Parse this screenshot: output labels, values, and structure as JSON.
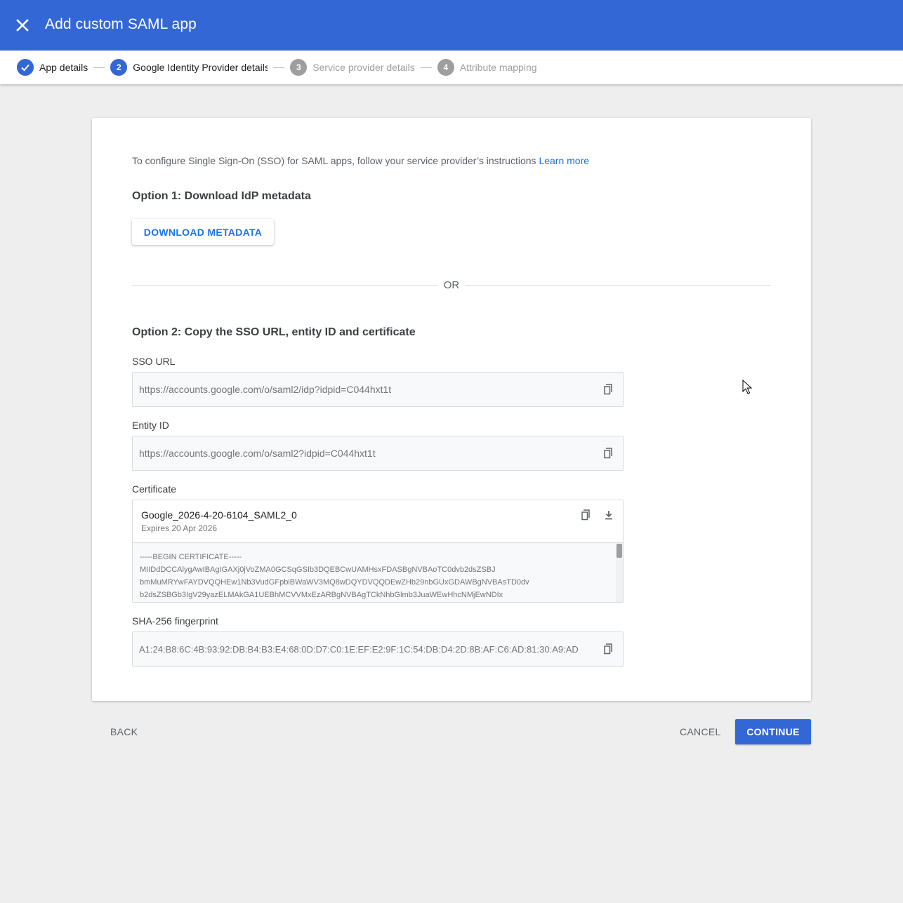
{
  "header": {
    "title": "Add custom SAML app",
    "close_icon": "close-icon",
    "color": "#3367d6"
  },
  "stepper": {
    "steps": [
      {
        "number": "",
        "label": "App details",
        "state": "done"
      },
      {
        "number": "2",
        "label": "Google Identity Provider details",
        "state": "active"
      },
      {
        "number": "3",
        "label": "Service provider details",
        "state": "todo"
      },
      {
        "number": "4",
        "label": "Attribute mapping",
        "state": "todo"
      }
    ]
  },
  "content": {
    "intro_text": "To configure Single Sign-On (SSO) for SAML apps, follow your service provider’s instructions ",
    "learn_more": "Learn more",
    "option1_heading": "Option 1: Download IdP metadata",
    "download_button": "DOWNLOAD METADATA",
    "or_text": "OR",
    "option2_heading": "Option 2: Copy the SSO URL, entity ID and certificate",
    "sso_url": {
      "label": "SSO URL",
      "value": "https://accounts.google.com/o/saml2/idp?idpid=C044hxt1t"
    },
    "entity_id": {
      "label": "Entity ID",
      "value": "https://accounts.google.com/o/saml2?idpid=C044hxt1t"
    },
    "certificate": {
      "label": "Certificate",
      "name": "Google_2026-4-20-6104_SAML2_0",
      "expires": "Expires 20 Apr 2026",
      "body": "-----BEGIN CERTIFICATE-----\nMIIDdDCCAlygAwIBAgIGAXj0jVoZMA0GCSqGSIb3DQEBCwUAMHsxFDASBgNVBAoTC0dvb2dsZSBJ\nbmMuMRYwFAYDVQQHEw1Nb3VudGFpbiBWaWV3MQ8wDQYDVQQDEwZHb29nbGUxGDAWBgNVBAsTD0dv\nb2dsZSBGb3IgV29yazELMAkGA1UEBhMCVVMxEzARBgNVBAgTCkNhbGlmb3JuaWEwHhcNMjEwNDIx"
    },
    "fingerprint": {
      "label": "SHA-256 fingerprint",
      "value": "A1:24:B8:6C:4B:93:92:DB:B4:B3:E4:68:0D:D7:C0:1E:EF:E2:9F:1C:54:DB:D4:2D:8B:AF:C6:AD:81:30:A9:AD"
    }
  },
  "footer": {
    "back": "BACK",
    "cancel": "CANCEL",
    "continue": "CONTINUE"
  }
}
